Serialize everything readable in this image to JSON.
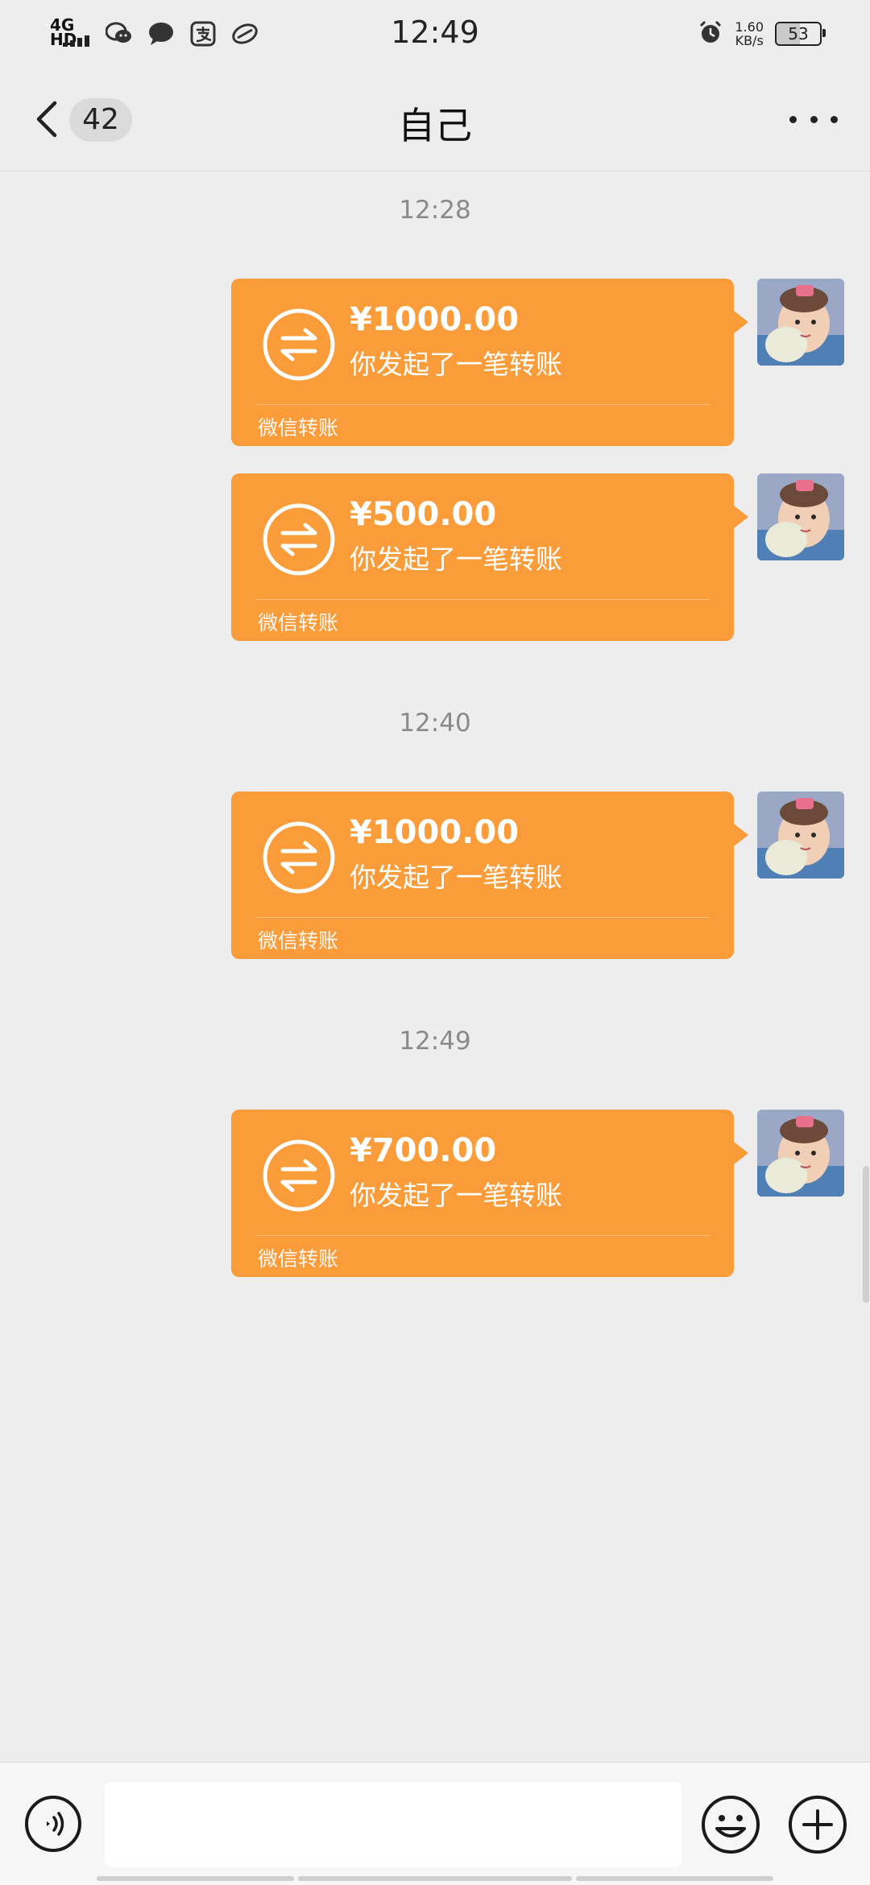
{
  "status_bar": {
    "network": "4G HD",
    "time": "12:49",
    "speed_value": "1.60",
    "speed_unit": "KB/s",
    "battery": "53",
    "app_icons": [
      "wechat-icon",
      "message-icon",
      "alipay-icon",
      "browser-icon"
    ]
  },
  "nav": {
    "unread_count": "42",
    "title": "自己"
  },
  "messages": [
    {
      "time": "12:28"
    },
    {
      "amount": "¥1000.00",
      "description": "你发起了一笔转账",
      "footer": "微信转账"
    },
    {
      "amount": "¥500.00",
      "description": "你发起了一笔转账",
      "footer": "微信转账"
    },
    {
      "time": "12:40"
    },
    {
      "amount": "¥1000.00",
      "description": "你发起了一笔转账",
      "footer": "微信转账"
    },
    {
      "time": "12:49"
    },
    {
      "amount": "¥700.00",
      "description": "你发起了一笔转账",
      "footer": "微信转账"
    }
  ],
  "colors": {
    "bubble": "#f99c39",
    "background": "#ededed",
    "timestamp": "#8a8a8a"
  }
}
